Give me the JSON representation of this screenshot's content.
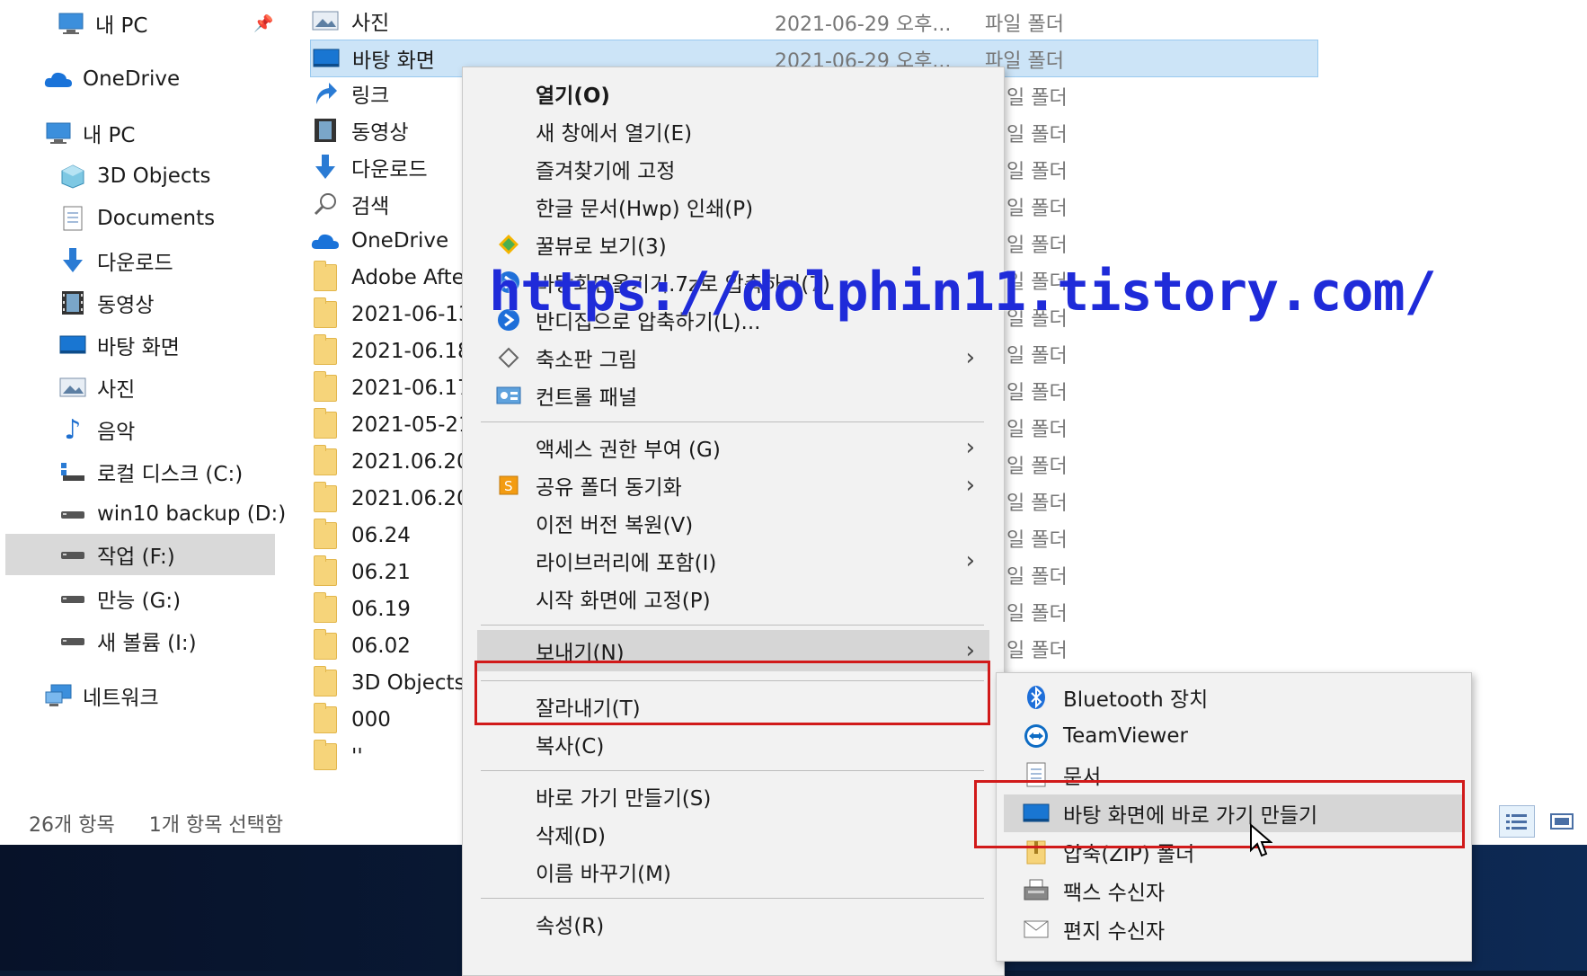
{
  "nav": {
    "pinned_pc": "내 PC",
    "onedrive": "OneDrive",
    "this_pc": "내 PC",
    "items": [
      {
        "label": "3D Objects",
        "icon": "3d-objects-icon"
      },
      {
        "label": "Documents",
        "icon": "documents-icon"
      },
      {
        "label": "다운로드",
        "icon": "download-icon"
      },
      {
        "label": "동영상",
        "icon": "video-icon"
      },
      {
        "label": "바탕 화면",
        "icon": "desktop-icon"
      },
      {
        "label": "사진",
        "icon": "pictures-icon"
      },
      {
        "label": "음악",
        "icon": "music-icon"
      },
      {
        "label": "로컬 디스크 (C:)",
        "icon": "local-disk-icon"
      },
      {
        "label": "win10 backup (D:)",
        "icon": "drive-icon"
      },
      {
        "label": "작업 (F:)",
        "icon": "drive-icon"
      },
      {
        "label": "만능 (G:)",
        "icon": "drive-icon"
      },
      {
        "label": "새 볼륨 (I:)",
        "icon": "drive-icon"
      }
    ],
    "network": "네트워크"
  },
  "files": [
    {
      "name": "사진",
      "date": "2021-06-29 오후...",
      "type": "파일 폴더"
    },
    {
      "name": "바탕 화면",
      "date": "2021-06-29 오후...",
      "type": "파일 폴더"
    },
    {
      "name": "링크",
      "type": "일 폴더"
    },
    {
      "name": "동영상",
      "type": "일 폴더"
    },
    {
      "name": "다운로드",
      "type": "일 폴더"
    },
    {
      "name": "검색",
      "type": "일 폴더"
    },
    {
      "name": "OneDrive",
      "type": "일 폴더"
    },
    {
      "name": "Adobe Afte",
      "type": "일 폴더"
    },
    {
      "name": "2021-06-13",
      "type": "일 폴더"
    },
    {
      "name": "2021-06.18",
      "type": "일 폴더"
    },
    {
      "name": "2021-06.17",
      "type": "일 폴더"
    },
    {
      "name": "2021-05-21",
      "type": "일 폴더"
    },
    {
      "name": "2021.06.20",
      "type": "일 폴더"
    },
    {
      "name": "2021.06.20",
      "type": "일 폴더"
    },
    {
      "name": "06.24",
      "type": "일 폴더"
    },
    {
      "name": "06.21",
      "type": "일 폴더"
    },
    {
      "name": "06.19",
      "type": "일 폴더"
    },
    {
      "name": "06.02",
      "type": "일 폴더"
    },
    {
      "name": "3D Objects"
    },
    {
      "name": "000"
    },
    {
      "name": "''"
    }
  ],
  "status": {
    "count": "26개 항목",
    "selected": "1개 항목 선택함"
  },
  "context_menu": [
    {
      "label": "열기(O)"
    },
    {
      "label": "새 창에서 열기(E)"
    },
    {
      "label": "즐겨찾기에 고정"
    },
    {
      "label": "한글 문서(Hwp) 인쇄(P)"
    },
    {
      "label": "꿀뷰로 보기(3)"
    },
    {
      "label": "바탕화면옮기기.7z로 압축하기(7)"
    },
    {
      "label": "반디집으로 압축하기(L)..."
    },
    {
      "label": "축소판 그림"
    },
    {
      "label": "컨트롤 패널"
    },
    {
      "label": "액세스 권한 부여 (G)"
    },
    {
      "label": "공유 폴더 동기화"
    },
    {
      "label": "이전 버전 복원(V)"
    },
    {
      "label": "라이브러리에 포함(I)"
    },
    {
      "label": "시작 화면에 고정(P)"
    },
    {
      "label": "보내기(N)"
    },
    {
      "label": "잘라내기(T)"
    },
    {
      "label": "복사(C)"
    },
    {
      "label": "바로 가기 만들기(S)"
    },
    {
      "label": "삭제(D)"
    },
    {
      "label": "이름 바꾸기(M)"
    },
    {
      "label": "속성(R)"
    }
  ],
  "send_to": [
    {
      "label": "Bluetooth 장치"
    },
    {
      "label": "TeamViewer"
    },
    {
      "label": "문서"
    },
    {
      "label": "바탕 화면에 바로 가기 만들기"
    },
    {
      "label": "압축(ZIP) 폴더"
    },
    {
      "label": "팩스 수신자"
    },
    {
      "label": "편지 수신자"
    }
  ],
  "watermark": "https://dolphin11.tistory.com/",
  "colors": {
    "selection": "#cce4f7",
    "highlight_box": "#d11a1a",
    "watermark": "#1f2bd9"
  }
}
